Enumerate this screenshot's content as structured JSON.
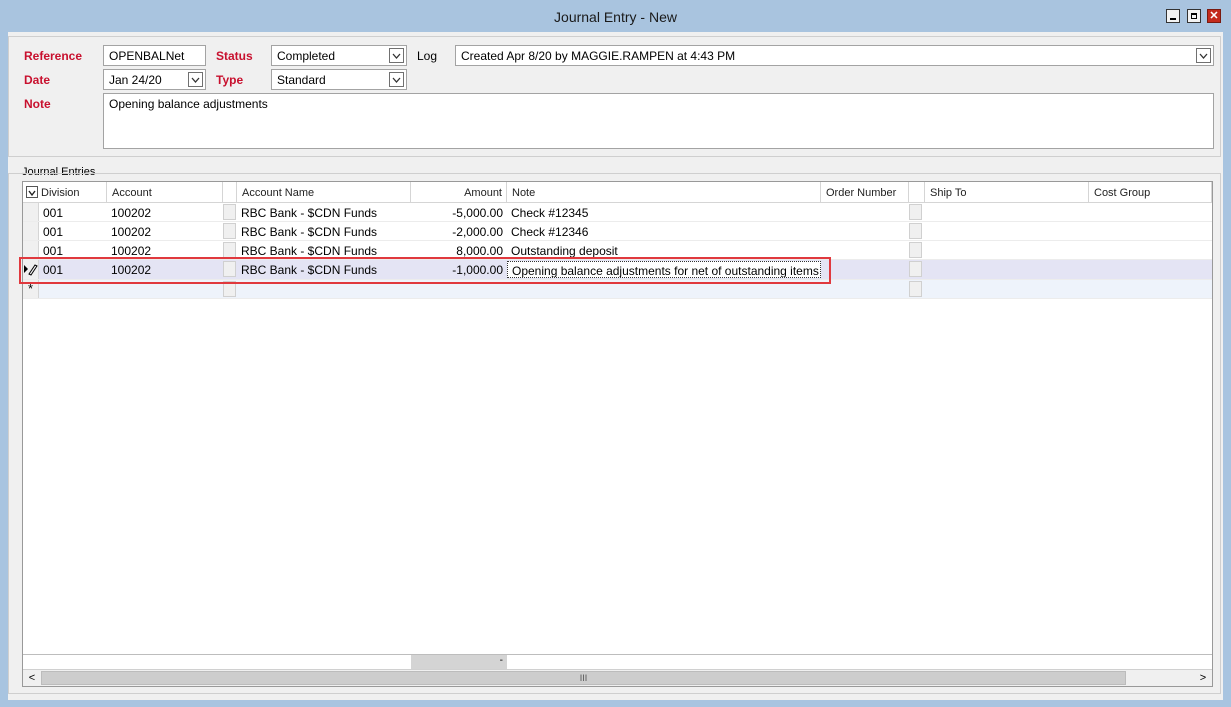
{
  "window": {
    "title": "Journal Entry - New",
    "minimize_icon": "minimize-icon",
    "maximize_icon": "maximize-icon",
    "close_label": "✕"
  },
  "form": {
    "reference_label": "Reference",
    "reference_value": "OPENBALNet",
    "status_label": "Status",
    "status_value": "Completed",
    "log_label": "Log",
    "log_value": "Created Apr 8/20 by MAGGIE.RAMPEN at 4:43 PM",
    "date_label": "Date",
    "date_value": "Jan 24/20",
    "type_label": "Type",
    "type_value": "Standard",
    "note_label": "Note",
    "note_value": "Opening balance adjustments"
  },
  "grid": {
    "group_label": "Journal Entries",
    "columns": [
      "Division",
      "Account",
      "Account Name",
      "Amount",
      "Note",
      "Order Number",
      "Ship To",
      "Cost Group"
    ],
    "rows": [
      {
        "division": "001",
        "account": "100202",
        "account_name": "RBC Bank -  $CDN Funds",
        "amount": "-5,000.00",
        "note": "Check #12345"
      },
      {
        "division": "001",
        "account": "100202",
        "account_name": "RBC Bank -  $CDN Funds",
        "amount": "-2,000.00",
        "note": "Check #12346"
      },
      {
        "division": "001",
        "account": "100202",
        "account_name": "RBC Bank -  $CDN Funds",
        "amount": "8,000.00",
        "note": "Outstanding deposit"
      },
      {
        "division": "001",
        "account": "100202",
        "account_name": "RBC Bank -  $CDN Funds",
        "amount": "-1,000.00",
        "note": "Opening balance adjustments for net of outstanding items"
      }
    ],
    "new_row_marker": "*",
    "footer_amount": "-",
    "scroll_thumb": "III",
    "scroll_left": "<",
    "scroll_right": ">"
  },
  "colors": {
    "required_label": "#c8102e",
    "highlight": "#e0393e",
    "titlebar": "#a9c4df"
  }
}
